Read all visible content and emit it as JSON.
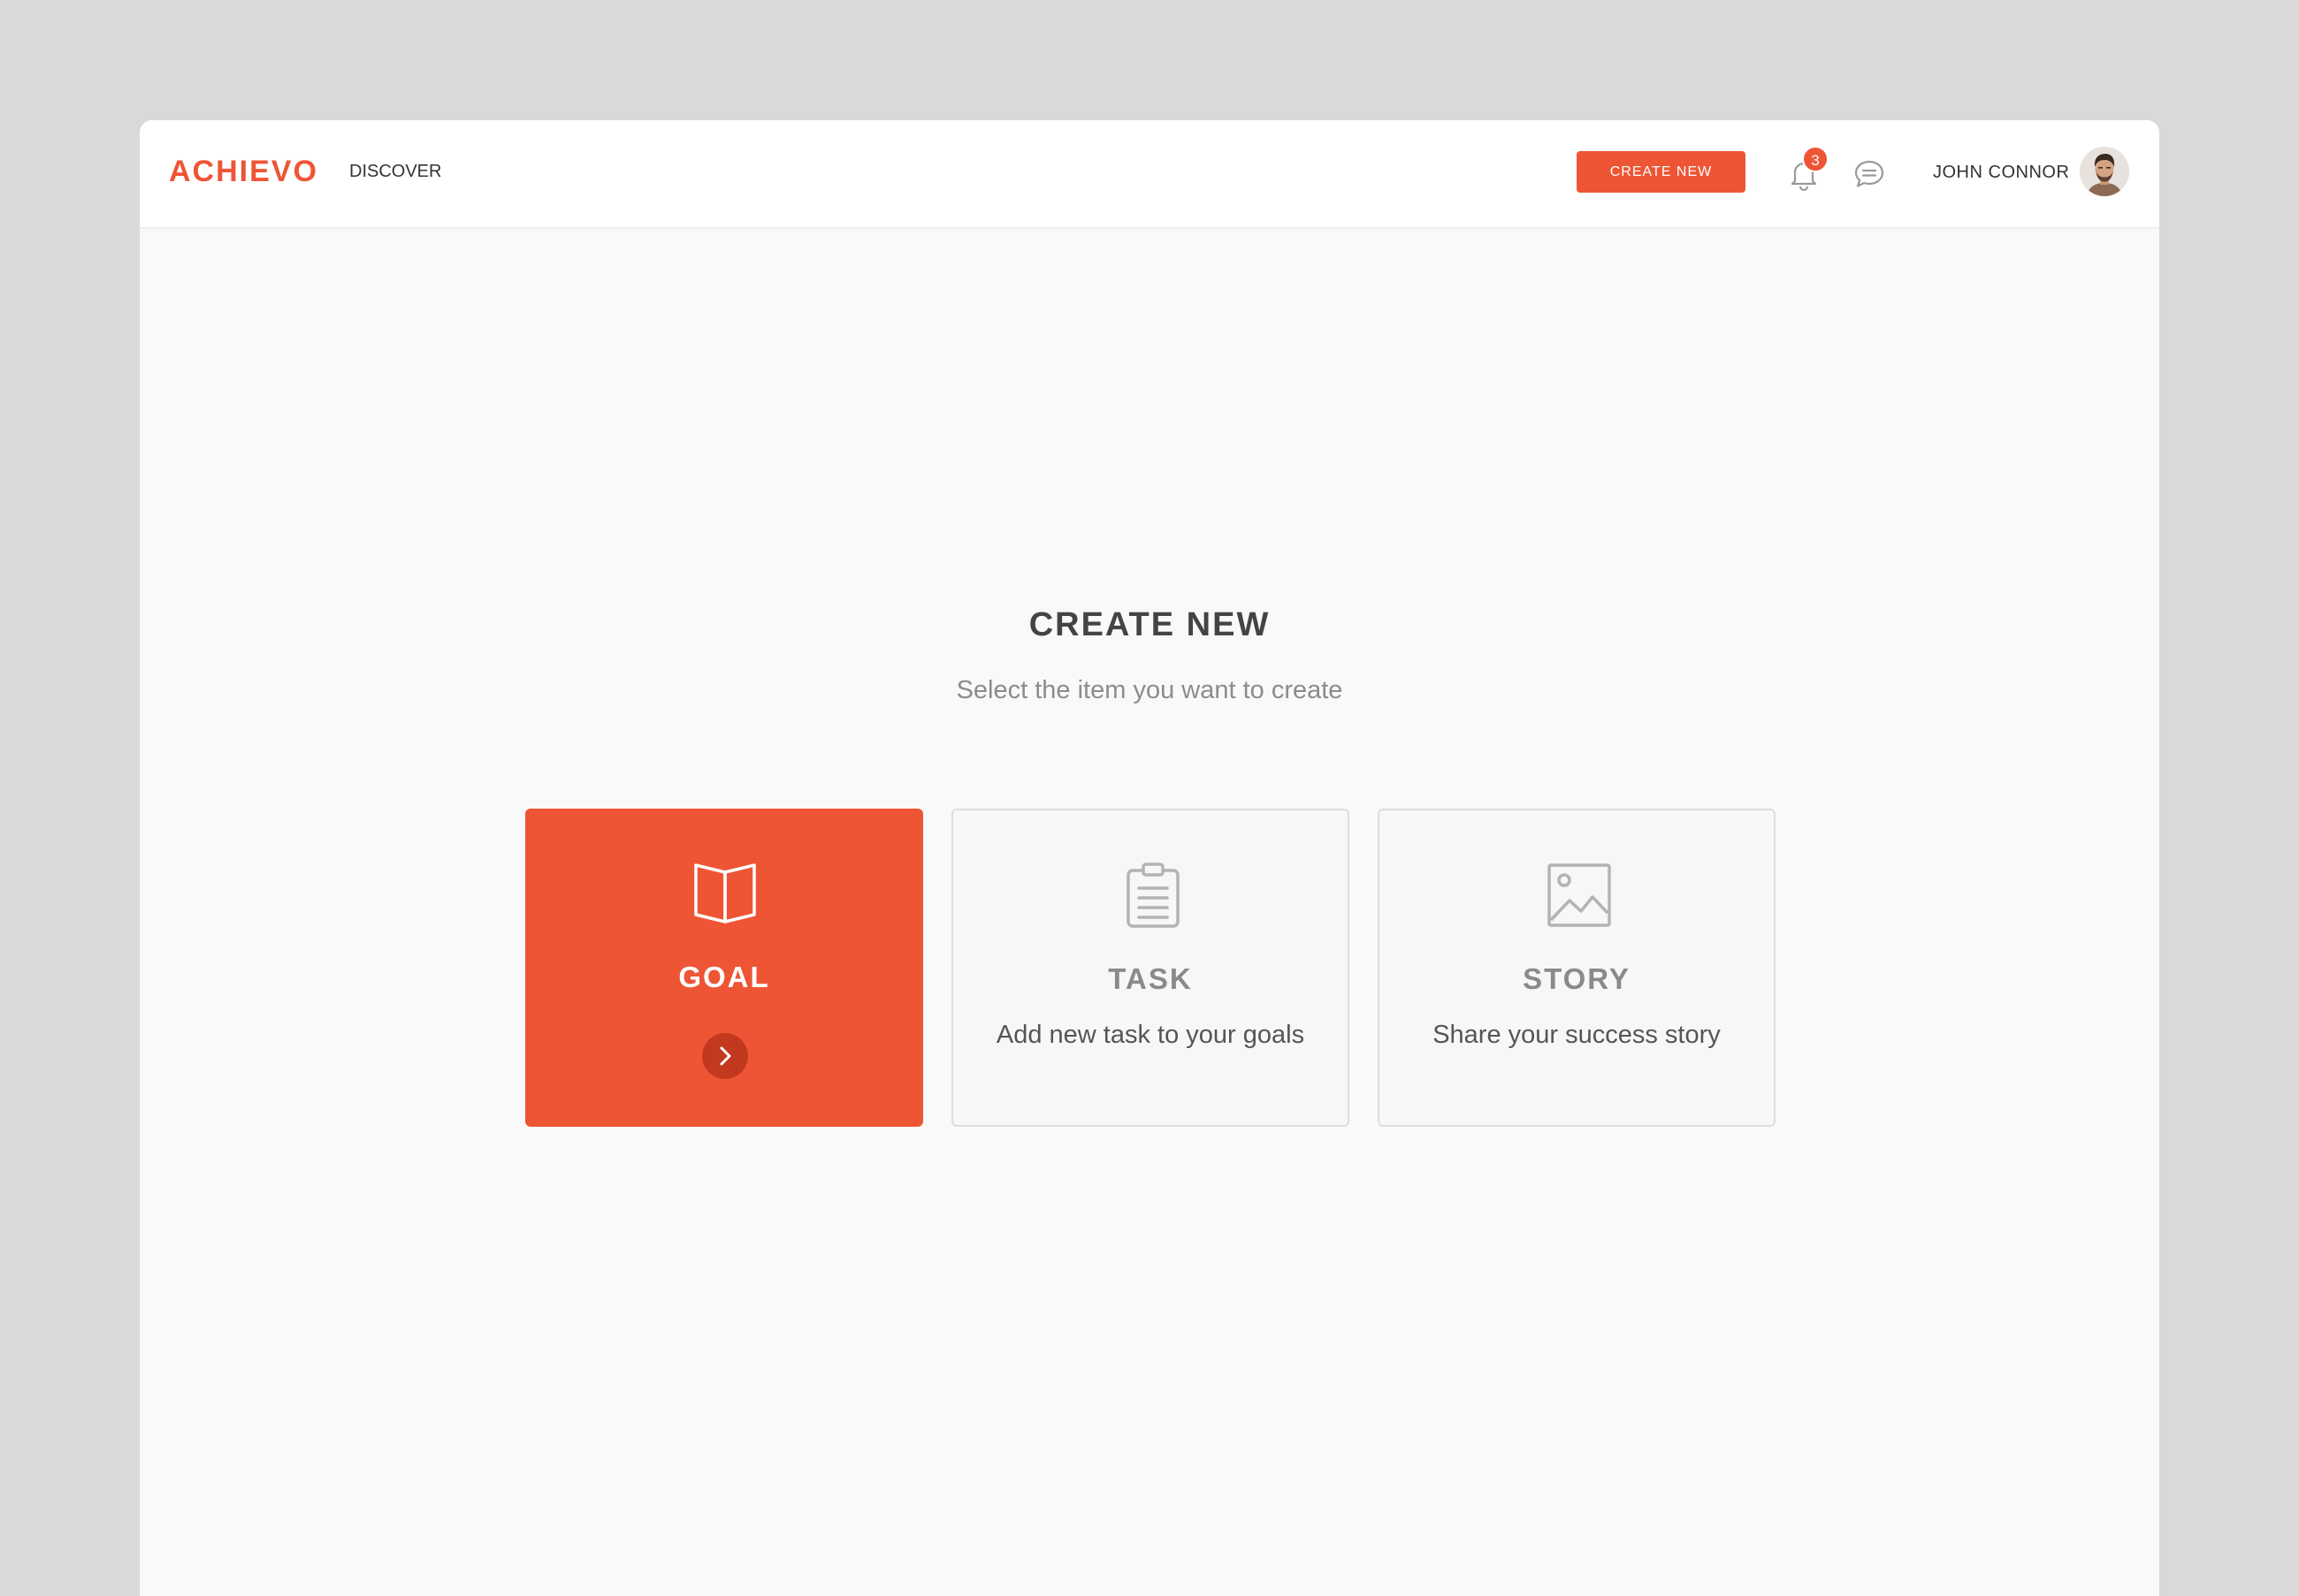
{
  "header": {
    "logo": "ACHIEVO",
    "nav_discover": "DISCOVER",
    "create_button": "CREATE NEW",
    "notification_count": "3",
    "user_name": "JOHN CONNOR"
  },
  "main": {
    "title": "CREATE NEW",
    "subtitle": "Select the item you want to create",
    "cards": [
      {
        "title": "GOAL",
        "description": "",
        "icon": "book-icon",
        "selected": true
      },
      {
        "title": "TASK",
        "description": "Add new task to your goals",
        "icon": "clipboard-icon",
        "selected": false
      },
      {
        "title": "STORY",
        "description": "Share your success story",
        "icon": "image-icon",
        "selected": false
      }
    ]
  },
  "colors": {
    "accent": "#ee5535",
    "accent_dark": "#c2391f",
    "page_background": "#d9d9d9",
    "content_background": "#f9f9f9"
  }
}
